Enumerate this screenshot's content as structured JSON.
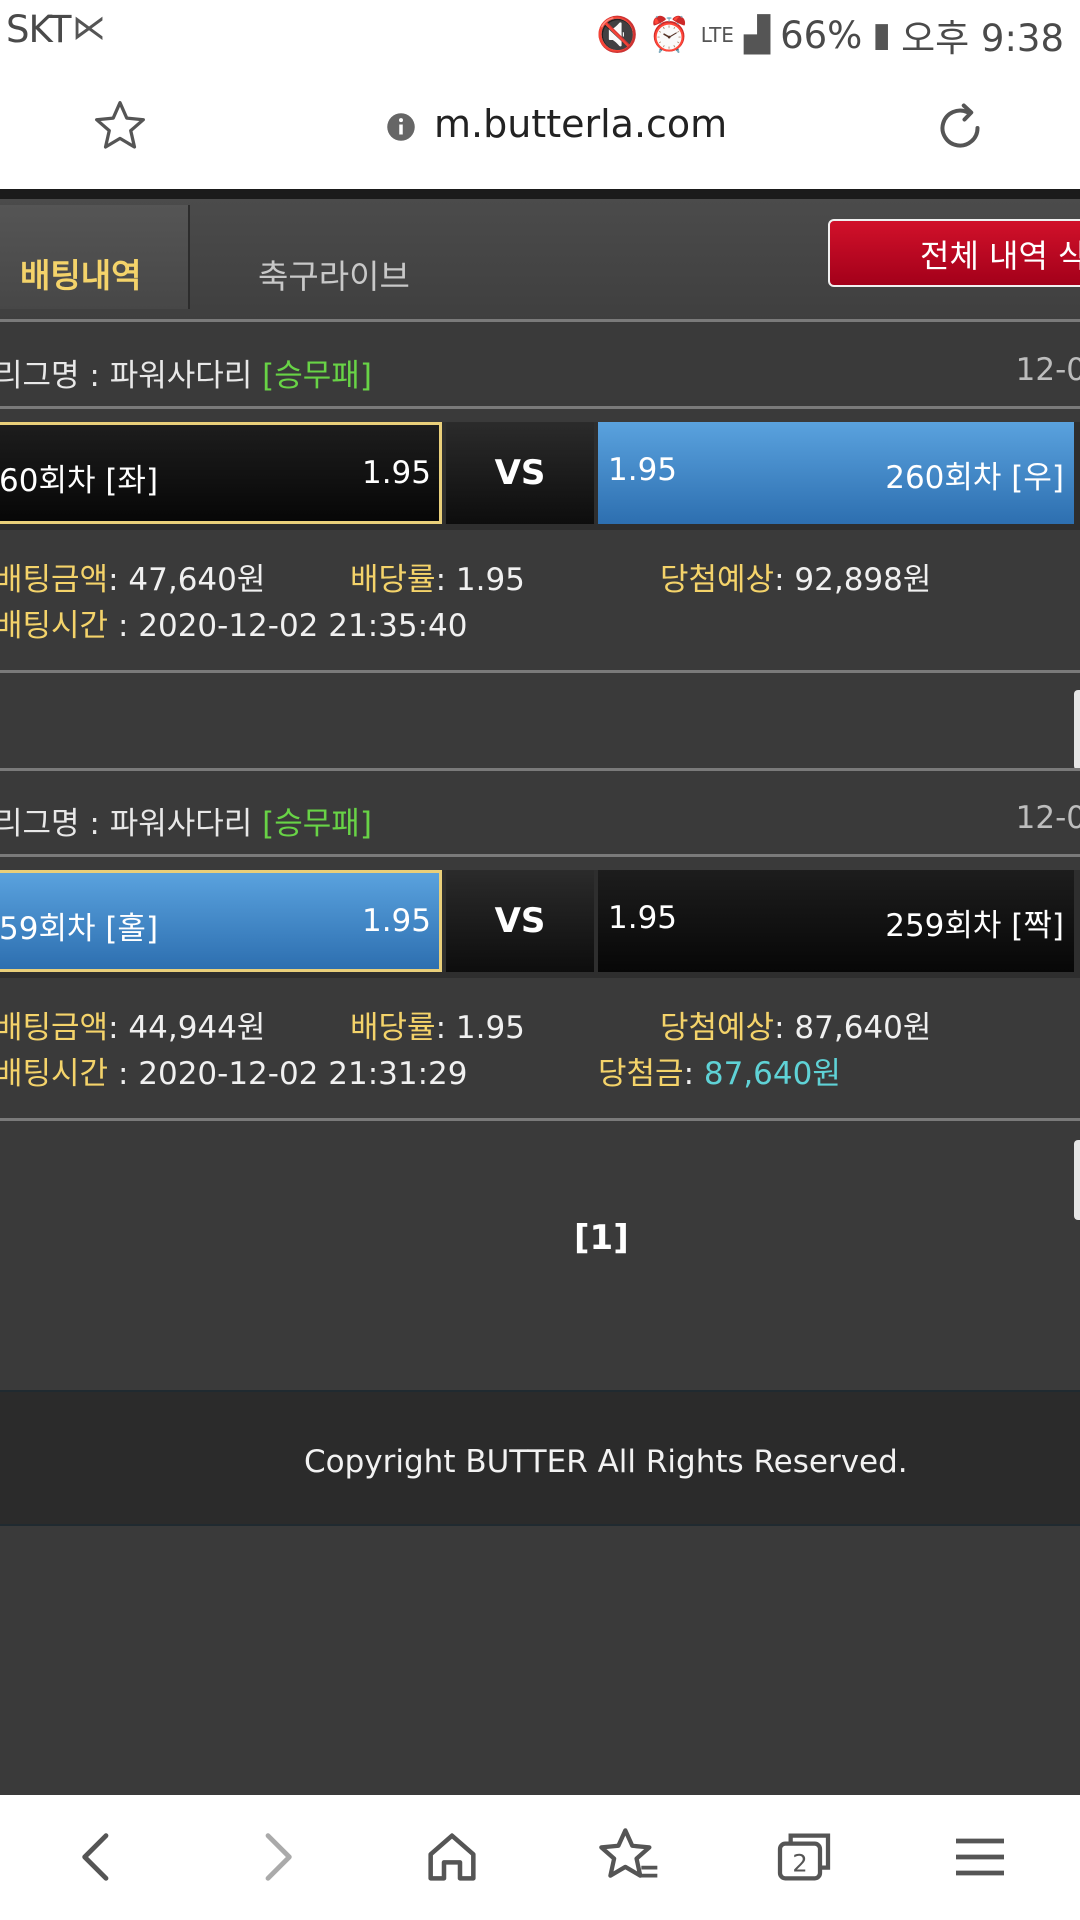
{
  "status": {
    "carrier": "SKT",
    "battery": "66%",
    "time": "오후 9:38",
    "network": "LTE"
  },
  "browser": {
    "url": "m.butterla.com"
  },
  "tabs": [
    {
      "label": "배팅내역"
    },
    {
      "label": "축구라이브"
    }
  ],
  "delete_button": {
    "label": "전체 내역 삭"
  },
  "bets": [
    {
      "league_prefix": "리그명 : 파워사다리 ",
      "league_tag": "[승무패]",
      "date": "12-0",
      "left_name": "60회차 [좌]",
      "left_odd": "1.95",
      "vs": "VS",
      "right_odd": "1.95",
      "right_name": "260회차 [우]",
      "amount_label": "배팅금액",
      "amount_value": ": 47,640원",
      "rate_label": "배당률",
      "rate_value": ": 1.95",
      "expect_label": "당첨예상",
      "expect_value": ": 92,898원",
      "time_label": "배팅시간",
      "time_value": " : 2020-12-02 21:35:40"
    },
    {
      "league_prefix": "리그명 : 파워사다리 ",
      "league_tag": "[승무패]",
      "date": "12-0",
      "left_name": "59회차 [홀]",
      "left_odd": "1.95",
      "vs": "VS",
      "right_odd": "1.95",
      "right_name": "259회차 [짝]",
      "amount_label": "배팅금액",
      "amount_value": ": 44,944원",
      "rate_label": "배당률",
      "rate_value": ": 1.95",
      "expect_label": "당첨예상",
      "expect_value": ": 87,640원",
      "time_label": "배팅시간",
      "time_value": " : 2020-12-02 21:31:29",
      "win_label": "당첨금",
      "win_value": "87,640원"
    }
  ],
  "pager": {
    "current": "[1]"
  },
  "footer": {
    "text": "Copyright BUTTER All Rights Reserved."
  },
  "colors": {
    "accent_yellow": "#f4d36a",
    "tag_green": "#68d346",
    "win_cyan": "#5fd2d6",
    "delete_red": "#c10a22",
    "pick_blue": "#3d86c9"
  }
}
